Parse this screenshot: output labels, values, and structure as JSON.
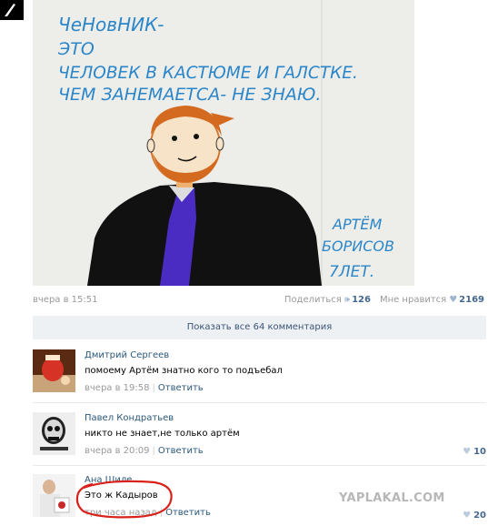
{
  "drawing_text": {
    "line1": "ЧеНовНИК-",
    "line2": "ЭТО",
    "line3": "ЧЕЛОВЕК В КАСТЮМЕ И ГАЛСТКЕ.",
    "line4": "ЧЕМ ЗАНЕМАЕТСА- НЕ ЗНАЮ.",
    "sig1": "АРТЁМ",
    "sig2": "БОРИСОВ",
    "sig3": "7ЛЕТ."
  },
  "post": {
    "time": "вчера в 15:51",
    "share_label": "Поделиться",
    "share_count": "126",
    "like_label": "Мне нравится",
    "like_count": "2169"
  },
  "show_all": "Показать все 64 комментария",
  "comments": [
    {
      "author": "Дмитрий Сергеев",
      "text": "помоему Артём знатно кого то подъебал",
      "time": "вчера в 19:58",
      "reply": "Ответить",
      "likes": ""
    },
    {
      "author": "Павел Кондратьев",
      "text": "никто не знает,не только артём",
      "time": "вчера в 20:09",
      "reply": "Ответить",
      "likes": "10"
    },
    {
      "author": "Ана Шиле",
      "text": "Это ж Кадыров",
      "time": "три часа назад",
      "reply": "Ответить",
      "likes": "20"
    }
  ],
  "watermark": "YAPLAKAL.COM",
  "colors": {
    "link": "#2b587a",
    "muted": "#999999",
    "bar_bg": "#eef1f4",
    "ink_blue": "#2a86c9",
    "annotation_red": "#d9221c"
  },
  "icons": {
    "share": "megaphone-icon",
    "like": "heart-icon"
  }
}
